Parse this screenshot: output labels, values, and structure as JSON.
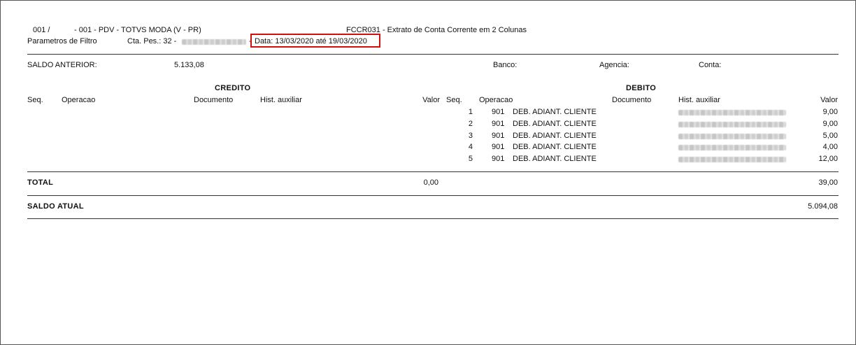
{
  "header": {
    "company_code": "001 /",
    "branch": "- 001 - PDV - TOTVS MODA (V - PR)",
    "report_title": "FCCR031 - Extrato de Conta Corrente em 2 Colunas",
    "filter_label": "Parametros de Filtro",
    "account_prefix": "Cta. Pes.: 32 -",
    "account_sep": "-",
    "date_range": "Data: 13/03/2020 até 19/03/2020"
  },
  "previous_balance": {
    "label": "SALDO ANTERIOR:",
    "value": "5.133,08",
    "bank_label": "Banco:",
    "agency_label": "Agencia:",
    "account_label": "Conta:"
  },
  "credit": {
    "title": "CREDITO",
    "columns": {
      "seq": "Seq.",
      "operation": "Operacao",
      "document": "Documento",
      "hist": "Hist. auxiliar",
      "value": "Valor"
    }
  },
  "debit": {
    "title": "DEBITO",
    "columns": {
      "seq": "Seq.",
      "operation": "Operacao",
      "document": "Documento",
      "hist": "Hist. auxiliar",
      "value": "Valor"
    },
    "rows": [
      {
        "seq": "1",
        "code": "901",
        "description": "DEB. ADIANT. CLIENTE",
        "value": "9,00"
      },
      {
        "seq": "2",
        "code": "901",
        "description": "DEB. ADIANT. CLIENTE",
        "value": "9,00"
      },
      {
        "seq": "3",
        "code": "901",
        "description": "DEB. ADIANT. CLIENTE",
        "value": "5,00"
      },
      {
        "seq": "4",
        "code": "901",
        "description": "DEB. ADIANT. CLIENTE",
        "value": "4,00"
      },
      {
        "seq": "5",
        "code": "901",
        "description": "DEB. ADIANT. CLIENTE",
        "value": "12,00"
      }
    ]
  },
  "totals": {
    "total_label": "TOTAL",
    "credit_total": "0,00",
    "debit_total": "39,00",
    "current_balance_label": "SALDO ATUAL",
    "current_balance": "5.094,08"
  }
}
